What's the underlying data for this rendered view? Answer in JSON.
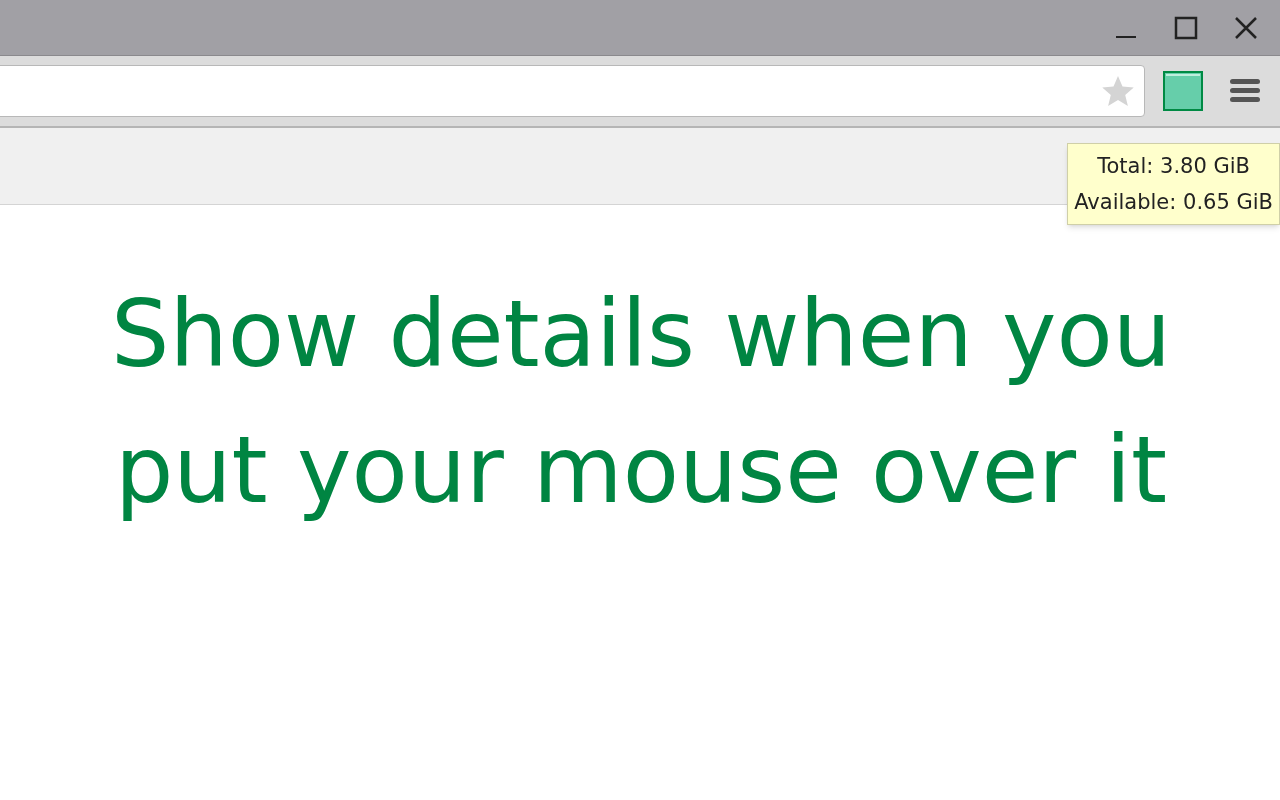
{
  "tooltip": {
    "lines": [
      "Total: 3.80 GiB",
      "Available: 0.65 GiB"
    ]
  },
  "headline": {
    "lines": [
      "Show details when you",
      "put your mouse over it"
    ]
  }
}
